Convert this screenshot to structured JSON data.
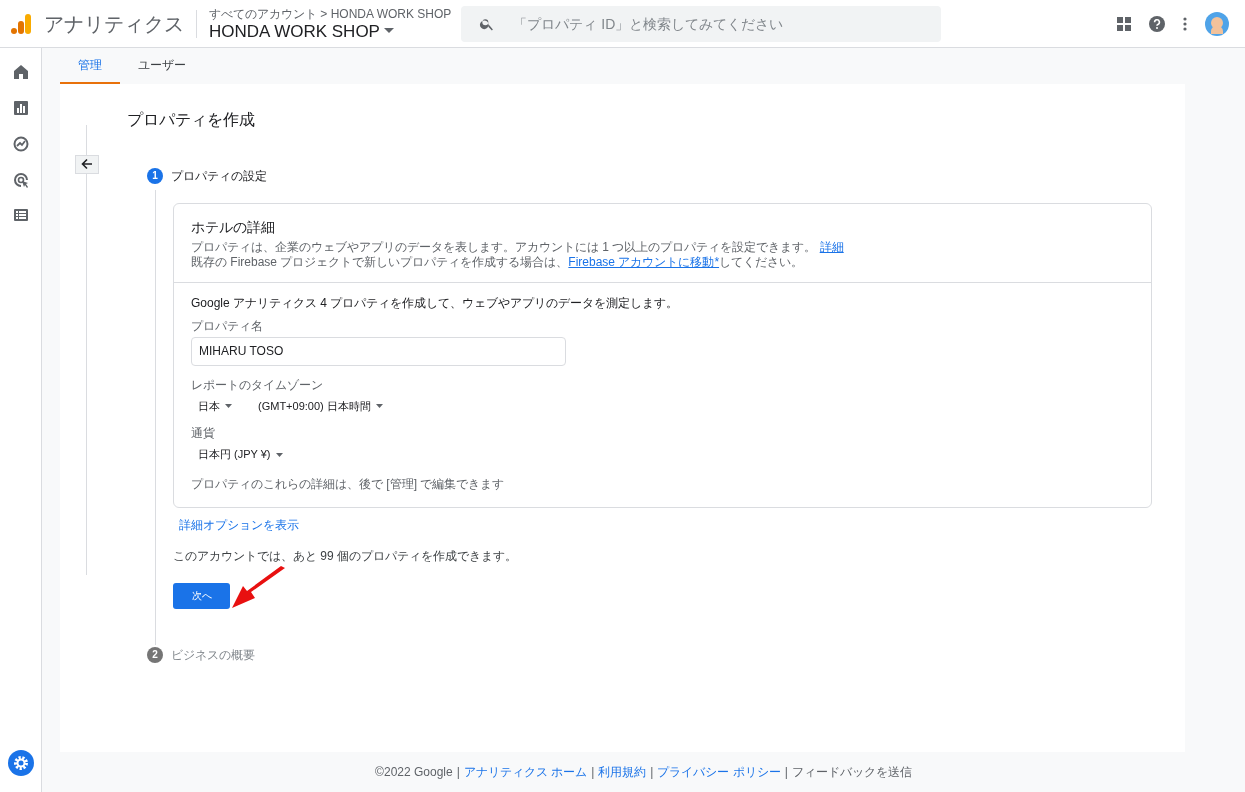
{
  "header": {
    "product": "アナリティクス",
    "breadcrumb": "すべてのアカウント > HONDA WORK SHOP",
    "account": "HONDA WORK SHOP",
    "search_placeholder": "「プロパティ ID」と検索してみてください"
  },
  "tabs": [
    {
      "label": "管理",
      "selected": true
    },
    {
      "label": "ユーザー",
      "selected": false
    }
  ],
  "title": "プロパティを作成",
  "steps": [
    {
      "number": "1",
      "label": "プロパティの設定",
      "active": true
    },
    {
      "number": "2",
      "label": "ビジネスの概要",
      "active": false
    }
  ],
  "details": {
    "heading": "ホテルの詳細",
    "description": "プロパティは、企業のウェブやアプリのデータを表します。アカウントには 1 つ以上のプロパティを設定できます。",
    "description_link": "詳細",
    "firebase_before": "既存の Firebase プロジェクトで新しいプロパティを作成する場合は、",
    "firebase_link": "Firebase アカウントに移動*",
    "firebase_after": "してください。"
  },
  "form": {
    "intro": "Google アナリティクス 4 プロパティを作成して、ウェブやアプリのデータを測定します。",
    "property_name": {
      "label": "プロパティ名",
      "value": "MIHARU TOSO"
    },
    "timezone": {
      "label": "レポートのタイムゾーン",
      "country": "日本",
      "zone": "(GMT+09:00) 日本時間"
    },
    "currency": {
      "label": "通貨",
      "value": "日本円 (JPY ¥)"
    },
    "note": "プロパティのこれらの詳細は、後で [管理] で編集できます"
  },
  "advanced_link": "詳細オプションを表示",
  "quota": "このアカウントでは、あと 99 個のプロパティを作成できます。",
  "next_button": "次へ",
  "footer": [
    {
      "kind": "text",
      "text": "©2022 Google"
    },
    {
      "kind": "separator",
      "text": "|"
    },
    {
      "kind": "link",
      "text": "アナリティクス ホーム"
    },
    {
      "kind": "separator",
      "text": "|"
    },
    {
      "kind": "link",
      "text": "利用規約"
    },
    {
      "kind": "separator",
      "text": "|"
    },
    {
      "kind": "link",
      "text": "プライバシー ポリシー"
    },
    {
      "kind": "separator",
      "text": "|"
    },
    {
      "kind": "text",
      "text": "フィードバックを送信"
    }
  ]
}
